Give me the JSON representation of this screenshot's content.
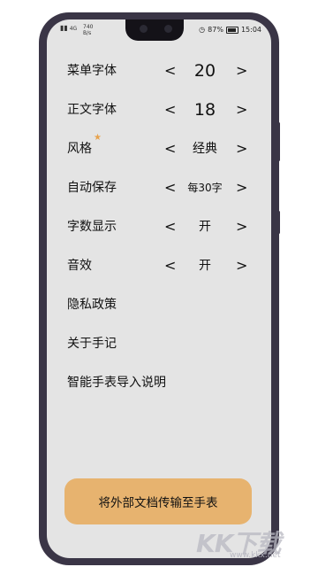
{
  "status_bar": {
    "network_type": "4G",
    "net_speed_value": "740",
    "net_speed_unit": "B/s",
    "battery_percent": "87%",
    "battery_level": 0.87,
    "time": "15:04"
  },
  "settings": [
    {
      "label": "菜单字体",
      "value": "20"
    },
    {
      "label": "正文字体",
      "value": "18"
    },
    {
      "label": "风格",
      "value": "经典"
    },
    {
      "label": "自动保存",
      "value": "每30字"
    },
    {
      "label": "字数显示",
      "value": "开"
    },
    {
      "label": "音效",
      "value": "开"
    }
  ],
  "arrows": {
    "left": "<",
    "right": ">"
  },
  "star_glyph": "★",
  "links": [
    {
      "label": "隐私政策"
    },
    {
      "label": "关于手记"
    },
    {
      "label": "智能手表导入说明"
    }
  ],
  "cta": {
    "label": "将外部文档传输至手表"
  },
  "watermark": {
    "logo": "KK下载",
    "url": "www.kkx.net"
  },
  "colors": {
    "screen_bg": "#e4e4e4",
    "cta_bg": "#e7b36f",
    "star": "#e7a24c",
    "phone_frame": "#3a3546"
  }
}
